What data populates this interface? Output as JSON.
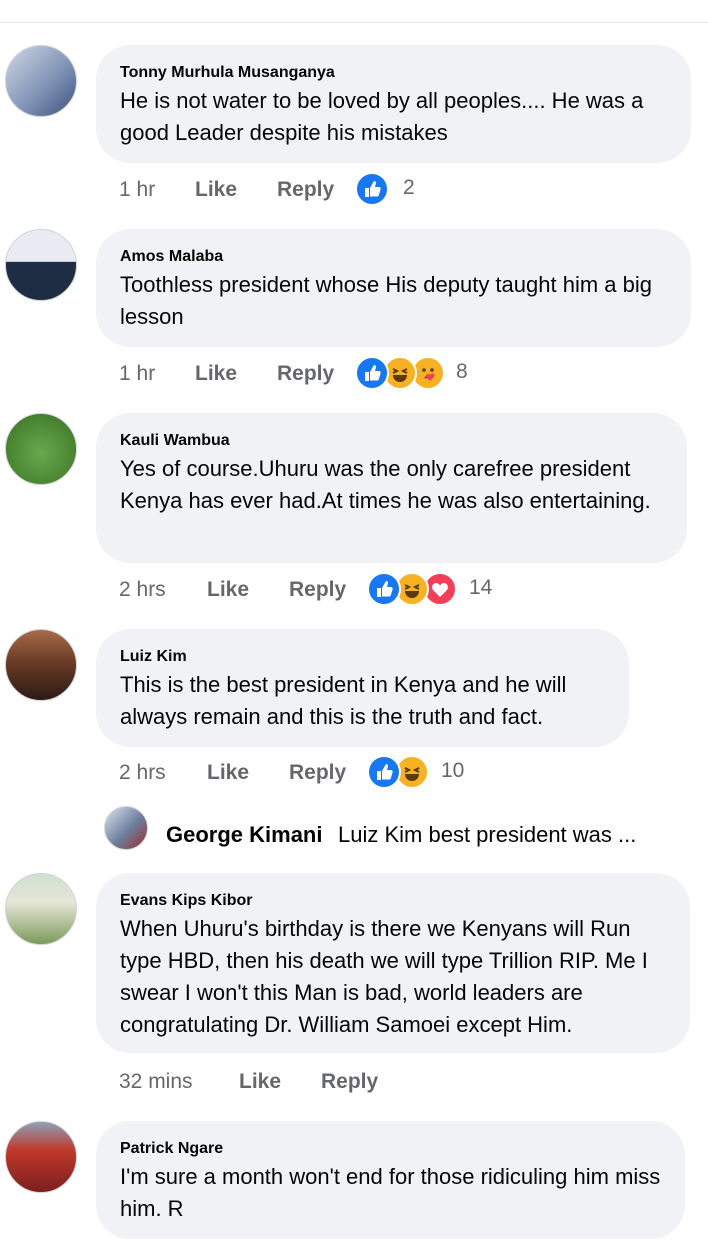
{
  "actions": {
    "like": "Like",
    "reply": "Reply"
  },
  "comments": [
    {
      "author": "Tonny Murhula Musanganya",
      "text": "He is not water to be loved by all peoples.... He was a good Leader despite his mistakes",
      "time": "1 hr",
      "reactions": [
        "like-icon"
      ],
      "count": "2"
    },
    {
      "author": "Amos Malaba",
      "text": "Toothless president whose His deputy taught him a big lesson",
      "time": "1 hr",
      "reactions": [
        "like-icon",
        "haha-icon",
        "care-icon"
      ],
      "count": "8"
    },
    {
      "author": "Kauli Wambua",
      "text": "Yes of course.Uhuru was the only carefree president Kenya has ever had.At times he was also entertaining.",
      "time": "2 hrs",
      "reactions": [
        "like-icon",
        "haha-icon",
        "love-icon"
      ],
      "count": "14"
    },
    {
      "author": "Luiz Kim",
      "text": "This is the best president in Kenya and he will always remain and this is the truth and fact.",
      "time": "2 hrs",
      "reactions": [
        "like-icon",
        "haha-icon"
      ],
      "count": "10"
    },
    {
      "author": "Evans Kips Kibor",
      "text": "When Uhuru's birthday is there we Kenyans will Run type HBD, then his death we will type Trillion RIP. Me I swear I won't this Man is bad, world leaders are congratulating Dr. William Samoei except Him.",
      "time": "32 mins"
    },
    {
      "author": "Patrick Ngare",
      "text": "I'm sure a month won't end for those ridiculing him miss him. R"
    }
  ],
  "reply_preview": {
    "author": "George Kimani",
    "text": "Luiz Kim best president was ..."
  },
  "colors": {
    "bubble": "#f0f2f5",
    "meta": "#65676b",
    "like": "#1877f2",
    "haha": "#f7b125",
    "love": "#f33e58"
  }
}
